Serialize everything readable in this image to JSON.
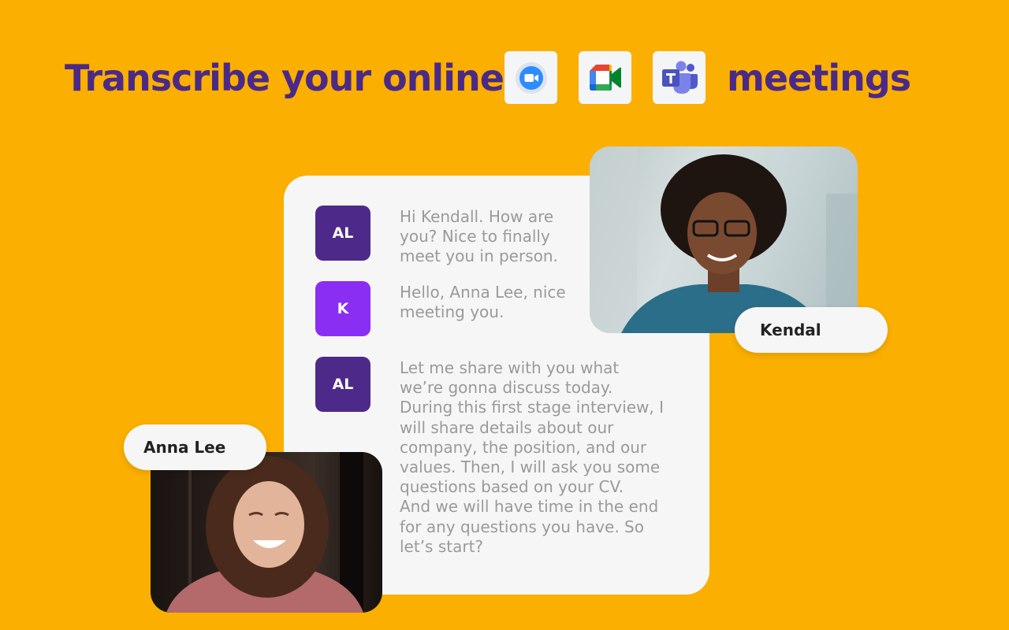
{
  "header": {
    "headline_left": "Transcribe your online",
    "headline_right": "meetings",
    "apps": [
      {
        "icon": "zoom-icon",
        "name": "Zoom"
      },
      {
        "icon": "google-meet-icon",
        "name": "Google Meet"
      },
      {
        "icon": "microsoft-teams-icon",
        "name": "Microsoft Teams"
      }
    ]
  },
  "transcript": {
    "messages": [
      {
        "initials": "AL",
        "text": "Hi Kendall. How are\nyou? Nice to finally\nmeet you in person."
      },
      {
        "initials": "K",
        "text": "Hello, Anna Lee, nice\nmeeting you."
      },
      {
        "initials": "AL",
        "text": "Let me share with you what\nwe’re gonna discuss today.\nDuring this first stage interview, I\nwill share details about our\ncompany, the position, and our\nvalues. Then, I will ask you some\nquestions based on your CV.\nAnd we will have time in the end\nfor any questions you have. So\nlet’s start?"
      }
    ]
  },
  "participants": {
    "kendal_name": "Kendal",
    "anna_name": "Anna Lee"
  },
  "colors": {
    "background": "#FBAF00",
    "headline": "#4A2A86",
    "avatar_al": "#4D2A8A",
    "avatar_k": "#8A2EF4"
  }
}
